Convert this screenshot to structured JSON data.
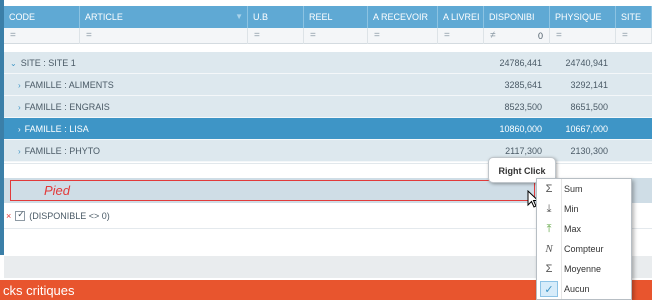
{
  "columns": [
    {
      "label": "CODE",
      "filter": "="
    },
    {
      "label": "ARTICLE",
      "filter": "="
    },
    {
      "label": "U.B",
      "filter": "="
    },
    {
      "label": "REEL",
      "filter": "="
    },
    {
      "label": "A RECEVOIR",
      "filter": "="
    },
    {
      "label": "A LIVREI",
      "filter": "="
    },
    {
      "label": "DISPONIBI",
      "filter": "≠",
      "filter_value": "0"
    },
    {
      "label": "PHYSIQUE",
      "filter": "="
    },
    {
      "label": "SITE",
      "filter": "="
    }
  ],
  "groups": [
    {
      "label": "SITE : SITE 1",
      "arrow": "⌄",
      "disponible": "24786,441",
      "physique": "24740,941",
      "selected": false
    },
    {
      "label": "FAMILLE : ALIMENTS",
      "arrow": "›",
      "disponible": "3285,641",
      "physique": "3292,141",
      "selected": false
    },
    {
      "label": "FAMILLE : ENGRAIS",
      "arrow": "›",
      "disponible": "8523,500",
      "physique": "8651,500",
      "selected": false
    },
    {
      "label": "FAMILLE : LISA",
      "arrow": "›",
      "disponible": "10860,000",
      "physique": "10667,000",
      "selected": true
    },
    {
      "label": "FAMILLE : PHYTO",
      "arrow": "›",
      "disponible": "2117,300",
      "physique": "2130,300",
      "selected": false
    }
  ],
  "footer": {
    "label": "Pied"
  },
  "active_filter": {
    "remove": "×",
    "text": "(DISPONIBLE <> 0)"
  },
  "bottom_banner": {
    "text": "cks critiques"
  },
  "tooltip": {
    "text": "Right Click"
  },
  "menu": {
    "items": [
      {
        "label": "Sum",
        "icon": "Σ",
        "icon_name": "sum-icon"
      },
      {
        "label": "Min",
        "icon": "⤓",
        "icon_name": "min-icon"
      },
      {
        "label": "Max",
        "icon": "⤒",
        "icon_name": "max-icon"
      },
      {
        "label": "Compteur",
        "icon": "N",
        "icon_name": "count-icon"
      },
      {
        "label": "Moyenne",
        "icon": "Σ",
        "icon_name": "average-icon"
      },
      {
        "label": "Aucun",
        "icon": "✓",
        "icon_name": "check-icon"
      }
    ]
  },
  "colors": {
    "header": "#5fa9d4",
    "group_row": "#dde8ee",
    "selected_row": "#3e95c6",
    "footer_row": "#cfdde6",
    "highlight_border": "#e23a3a",
    "banner": "#e8552e"
  }
}
